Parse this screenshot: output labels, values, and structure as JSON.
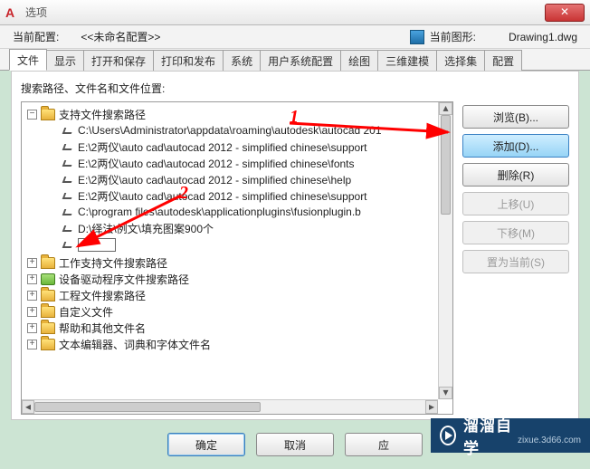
{
  "titlebar": {
    "title": "选项"
  },
  "header": {
    "current_config_label": "当前配置:",
    "current_config_value": "<<未命名配置>>",
    "current_drawing_label": "当前图形:",
    "current_drawing_value": "Drawing1.dwg"
  },
  "tabs": [
    "文件",
    "显示",
    "打开和保存",
    "打印和发布",
    "系统",
    "用户系统配置",
    "绘图",
    "三维建模",
    "选择集",
    "配置"
  ],
  "active_tab_index": 0,
  "panel": {
    "caption": "搜索路径、文件名和文件位置:",
    "tree": {
      "root_label": "支持文件搜索路径",
      "paths": [
        "C:\\Users\\Administrator\\appdata\\roaming\\autodesk\\autocad 201",
        "E:\\2两仪\\auto cad\\autocad 2012 - simplified chinese\\support",
        "E:\\2两仪\\auto cad\\autocad 2012 - simplified chinese\\fonts",
        "E:\\2两仪\\auto cad\\autocad 2012 - simplified chinese\\help",
        "E:\\2两仪\\auto cad\\autocad 2012 - simplified chinese\\support",
        "C:\\program files\\autodesk\\applicationplugins\\fusionplugin.b",
        "D:\\绎法\\例文\\填充图案900个"
      ],
      "editable_value": "",
      "siblings": [
        "工作支持文件搜索路径",
        "设备驱动程序文件搜索路径",
        "工程文件搜索路径",
        "自定义文件",
        "帮助和其他文件名",
        "文本编辑器、词典和字体文件名"
      ]
    },
    "buttons": {
      "browse": "浏览(B)...",
      "add": "添加(D)...",
      "delete": "删除(R)",
      "moveup": "上移(U)",
      "movedown": "下移(M)",
      "setcurrent": "置为当前(S)"
    }
  },
  "dialog_buttons": {
    "ok": "确定",
    "cancel": "取消",
    "apply": "应"
  },
  "annotations": {
    "one": "1",
    "two": "2"
  },
  "watermark": {
    "brand": "溜溜自学",
    "url": "zixue.3d66.com"
  }
}
